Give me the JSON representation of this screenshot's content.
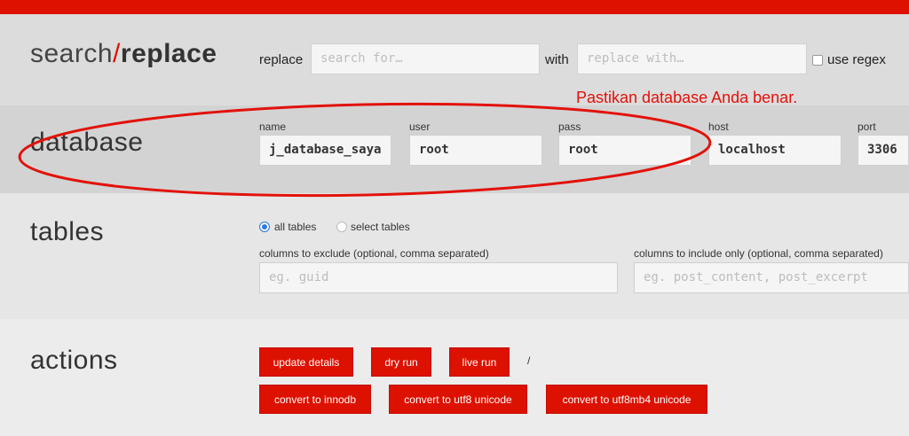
{
  "brand": {
    "part1": "search",
    "slash": "/",
    "part2": "replace"
  },
  "search": {
    "replace_label": "replace",
    "search_placeholder": "search for…",
    "with_label": "with",
    "replace_placeholder": "replace with…",
    "regex_label": "use regex"
  },
  "annotation": {
    "note": "Pastikan database Anda benar."
  },
  "database": {
    "title": "database",
    "fields": [
      {
        "label": "name",
        "value": "j_database_saya"
      },
      {
        "label": "user",
        "value": "root"
      },
      {
        "label": "pass",
        "value": "root"
      },
      {
        "label": "host",
        "value": "localhost"
      },
      {
        "label": "port",
        "value": "3306"
      }
    ]
  },
  "tables": {
    "title": "tables",
    "all_tables_label": "all tables",
    "select_tables_label": "select tables",
    "selected_option": "all tables",
    "exclude_label": "columns to exclude (optional, comma separated)",
    "exclude_placeholder": "eg. guid",
    "include_label": "columns to include only (optional, comma separated)",
    "include_placeholder": "eg. post_content, post_excerpt"
  },
  "actions": {
    "title": "actions",
    "update_details": "update details",
    "dry_run": "dry run",
    "live_run": "live run",
    "separator": "/",
    "convert_innodb": "convert to innodb",
    "convert_utf8": "convert to utf8 unicode",
    "convert_utf8mb4": "convert to utf8mb4 unicode"
  },
  "colors": {
    "accent": "#dd1100",
    "annotation": "#e2120b",
    "radio": "#2b7de0"
  }
}
